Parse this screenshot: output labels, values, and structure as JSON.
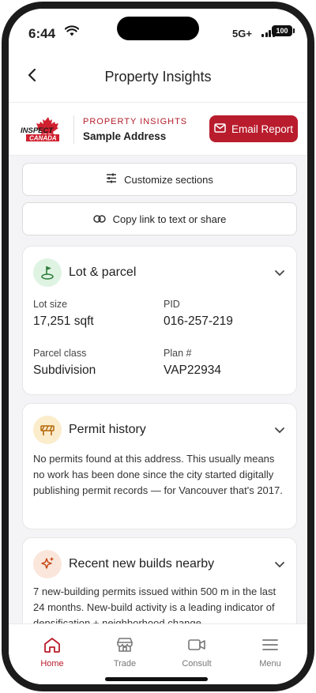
{
  "status": {
    "time": "6:44",
    "network": "5G+",
    "battery": "100"
  },
  "header": {
    "title": "Property Insights",
    "back_icon": "back-chevron-icon"
  },
  "brand": {
    "logo_text_top": "INSPECT",
    "logo_text_bottom": "CANADA",
    "kicker": "PROPERTY INSIGHTS",
    "address": "Sample Address",
    "email_button": "Email Report"
  },
  "actions": {
    "customize": "Customize sections",
    "copy_link": "Copy link to text or share"
  },
  "lot": {
    "title": "Lot & parcel",
    "fields": [
      {
        "label": "Lot size",
        "value": "17,251 sqft"
      },
      {
        "label": "PID",
        "value": "016-257-219"
      },
      {
        "label": "Parcel class",
        "value": "Subdivision"
      },
      {
        "label": "Plan #",
        "value": "VAP22934"
      }
    ]
  },
  "permit": {
    "title": "Permit history",
    "body": "No permits found at this address. This usually means no work has been done since the city started digitally publishing permit records — for Vancouver that's 2017."
  },
  "builds": {
    "title": "Recent new builds nearby",
    "body": "7 new-building permits issued within 500 m in the last 24 months. New-build activity is a leading indicator of densification + neighborhood change."
  },
  "tabs": [
    {
      "label": "Home",
      "icon": "home-icon",
      "active": true
    },
    {
      "label": "Trade",
      "icon": "storefront-icon",
      "active": false
    },
    {
      "label": "Consult",
      "icon": "video-camera-icon",
      "active": false
    },
    {
      "label": "Menu",
      "icon": "hamburger-menu-icon",
      "active": false
    }
  ],
  "colors": {
    "brand_red": "#b91c2c",
    "lot_icon_bg": "#dff3e3",
    "permit_icon_bg": "#fbeccb",
    "builds_icon_bg": "#fbe6dc"
  }
}
